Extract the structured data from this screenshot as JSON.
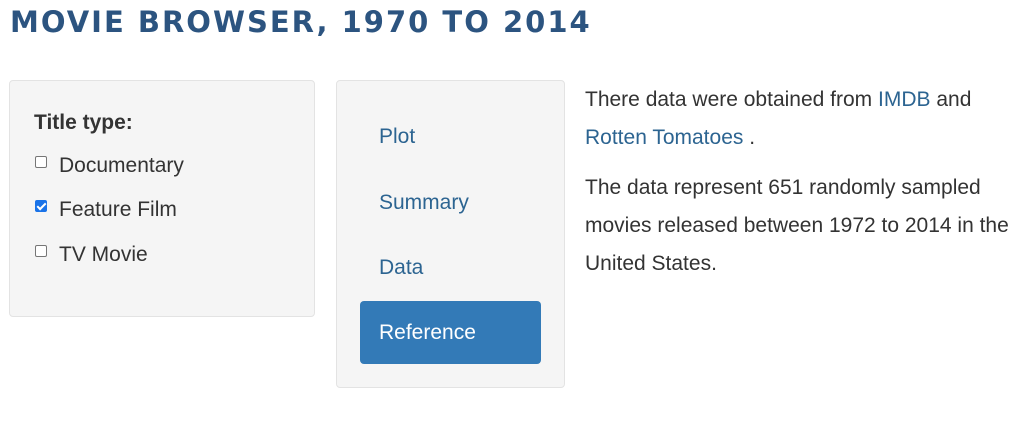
{
  "page_title": "MOVIE BROWSER, 1970 TO 2014",
  "filter": {
    "label": "Title type:",
    "options": [
      {
        "label": "Documentary",
        "checked": false
      },
      {
        "label": "Feature Film",
        "checked": true
      },
      {
        "label": "TV Movie",
        "checked": false
      }
    ]
  },
  "nav": {
    "items": [
      {
        "label": "Plot",
        "active": false
      },
      {
        "label": "Summary",
        "active": false
      },
      {
        "label": "Data",
        "active": false
      },
      {
        "label": "Reference",
        "active": true
      }
    ]
  },
  "description": {
    "p1_before": "There data were obtained from ",
    "link_imdb": "IMDB",
    "p1_and": " and",
    "link_rt": "Rotten Tomatoes",
    "p1_end": " .",
    "p2": "The data represent 651 randomly sampled movies released between 1972 to 2014 in the United States."
  },
  "colors": {
    "title": "#2c5480",
    "link": "#2c6491",
    "active_tab_bg": "#337ab7",
    "panel_bg": "#f5f5f5",
    "checkbox_checked": "#1a73e8"
  }
}
